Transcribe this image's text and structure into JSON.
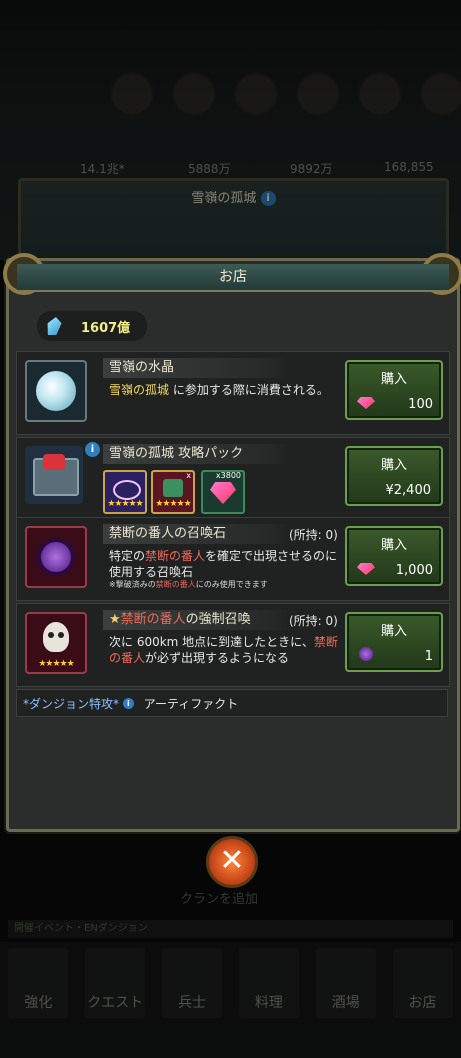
{
  "background": {
    "stats": [
      "14.1兆*",
      "5888万",
      "9892万",
      "168,855"
    ],
    "banner_title": "雪嶺の孤城",
    "info_symbol": "i",
    "event_strip": "開催イベント・ENダンジョン",
    "bottom_text": "クランを追加",
    "nav": [
      "強化",
      "クエスト",
      "兵士",
      "料理",
      "酒場",
      "お店"
    ]
  },
  "modal": {
    "title": "お店",
    "currency_value": "1607億"
  },
  "items": [
    {
      "title": "雪嶺の水晶",
      "desc_highlight": "雪嶺の孤城",
      "desc_rest": " に参加する際に消費される。",
      "buy_label": "購入",
      "price": "100"
    },
    {
      "title": "雪嶺の孤城 攻略パック",
      "buy_label": "購入",
      "price": "¥2,400",
      "bundle_qty": "x3800",
      "bundle_x": "x"
    },
    {
      "title": "禁断の番人の召喚石",
      "owned": "(所持: 0)",
      "desc_a": "特定の",
      "desc_highlight": "禁断の番人",
      "desc_b": "を確定で出現させるのに使用する召喚石",
      "note_a": "※撃破済みの",
      "note_highlight": "禁断の番人",
      "note_b": "にのみ使用できます",
      "buy_label": "購入",
      "price": "1,000"
    },
    {
      "title_prefix": "★",
      "title_highlight": "禁断の番人",
      "title_rest": "の強制召喚",
      "owned": "(所持: 0)",
      "desc_a": "次に 600km 地点に到達したときに、",
      "desc_highlight": "禁断の番人",
      "desc_b": "が必ず出現するようになる",
      "buy_label": "購入",
      "price": "1"
    }
  ],
  "artifact": {
    "label": "*ダンジョン特攻*",
    "value": "アーティファクト"
  },
  "close_symbol": "✕",
  "stars5": "★★★★★"
}
